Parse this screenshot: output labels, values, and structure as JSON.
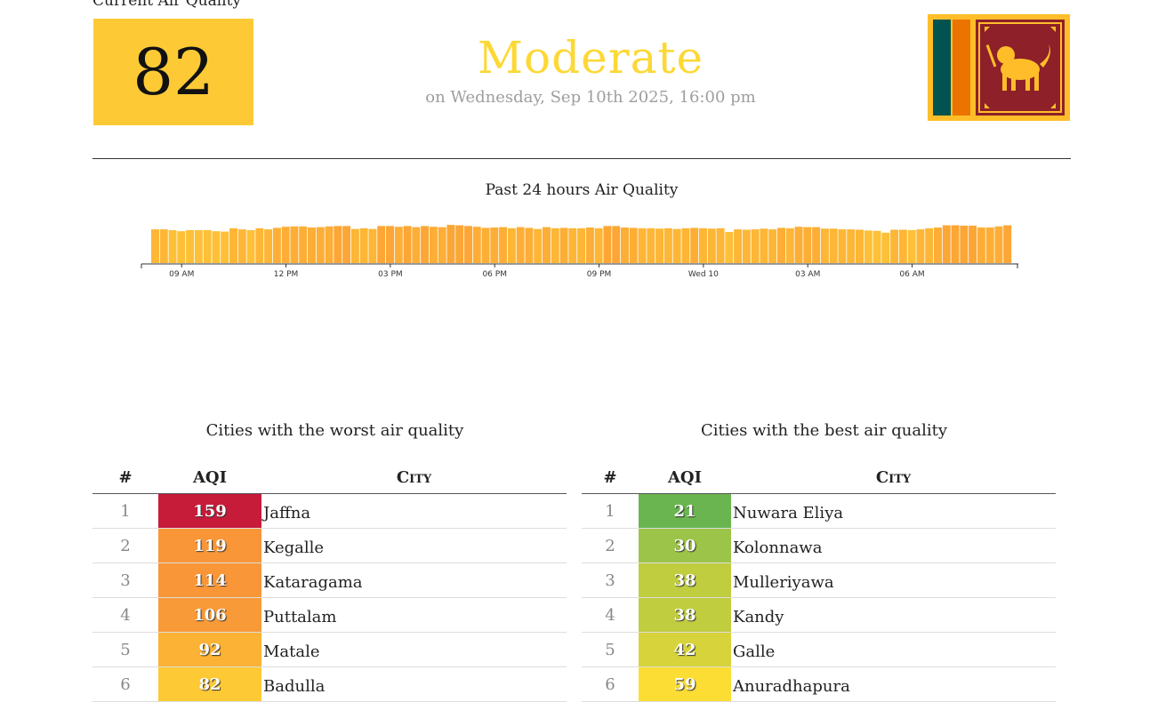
{
  "current": {
    "label": "Current Air Quality",
    "aqi": "82",
    "level": "Moderate",
    "timestamp": "on Wednesday, Sep 10th 2025, 16:00 pm",
    "level_color": "#fdd835",
    "box_color": "#fdca36"
  },
  "country_flag": "Sri Lanka flag",
  "chart_data": {
    "type": "bar",
    "title": "Past 24 hours Air Quality",
    "xlabel": "",
    "ylabel": "",
    "x_ticks": [
      "09 AM",
      "12 PM",
      "03 PM",
      "06 PM",
      "09 PM",
      "Wed 10",
      "03 AM",
      "06 AM"
    ],
    "ylim": [
      0,
      160
    ],
    "values": [
      91,
      91,
      89,
      86,
      89,
      89,
      89,
      86,
      85,
      94,
      91,
      89,
      94,
      91,
      95,
      98,
      99,
      99,
      96,
      97,
      99,
      100,
      100,
      92,
      94,
      92,
      100,
      100,
      98,
      100,
      97,
      100,
      98,
      97,
      103,
      102,
      100,
      98,
      95,
      96,
      97,
      94,
      97,
      95,
      92,
      97,
      94,
      95,
      94,
      94,
      96,
      94,
      100,
      100,
      96,
      95,
      94,
      94,
      93,
      94,
      92,
      94,
      95,
      94,
      93,
      94,
      84,
      91,
      90,
      91,
      93,
      91,
      95,
      94,
      98,
      97,
      97,
      93,
      93,
      91,
      91,
      90,
      88,
      87,
      82,
      90,
      90,
      89,
      91,
      94,
      96,
      102,
      102,
      101,
      101,
      96,
      96,
      99,
      102
    ],
    "grid": false
  },
  "worst": {
    "title": "Cities with the worst air quality",
    "headers": {
      "rank": "#",
      "aqi": "AQI",
      "city": "City"
    },
    "rows": [
      {
        "rank": "1",
        "aqi": "159",
        "city": "Jaffna",
        "color": "#c71b3a"
      },
      {
        "rank": "2",
        "aqi": "119",
        "city": "Kegalle",
        "color": "#f99638"
      },
      {
        "rank": "3",
        "aqi": "114",
        "city": "Kataragama",
        "color": "#f99638"
      },
      {
        "rank": "4",
        "aqi": "106",
        "city": "Puttalam",
        "color": "#f99a38"
      },
      {
        "rank": "5",
        "aqi": "92",
        "city": "Matale",
        "color": "#fcb234"
      },
      {
        "rank": "6",
        "aqi": "82",
        "city": "Badulla",
        "color": "#fdca36"
      }
    ]
  },
  "best": {
    "title": "Cities with the best air quality",
    "headers": {
      "rank": "#",
      "aqi": "AQI",
      "city": "City"
    },
    "rows": [
      {
        "rank": "1",
        "aqi": "21",
        "city": "Nuwara Eliya",
        "color": "#6ab54f"
      },
      {
        "rank": "2",
        "aqi": "30",
        "city": "Kolonnawa",
        "color": "#9cc448"
      },
      {
        "rank": "3",
        "aqi": "38",
        "city": "Mulleriyawa",
        "color": "#c0cd3f"
      },
      {
        "rank": "4",
        "aqi": "38",
        "city": "Kandy",
        "color": "#c0cd3f"
      },
      {
        "rank": "5",
        "aqi": "42",
        "city": "Galle",
        "color": "#d6d43a"
      },
      {
        "rank": "6",
        "aqi": "59",
        "city": "Anuradhapura",
        "color": "#fcdd34"
      }
    ]
  }
}
